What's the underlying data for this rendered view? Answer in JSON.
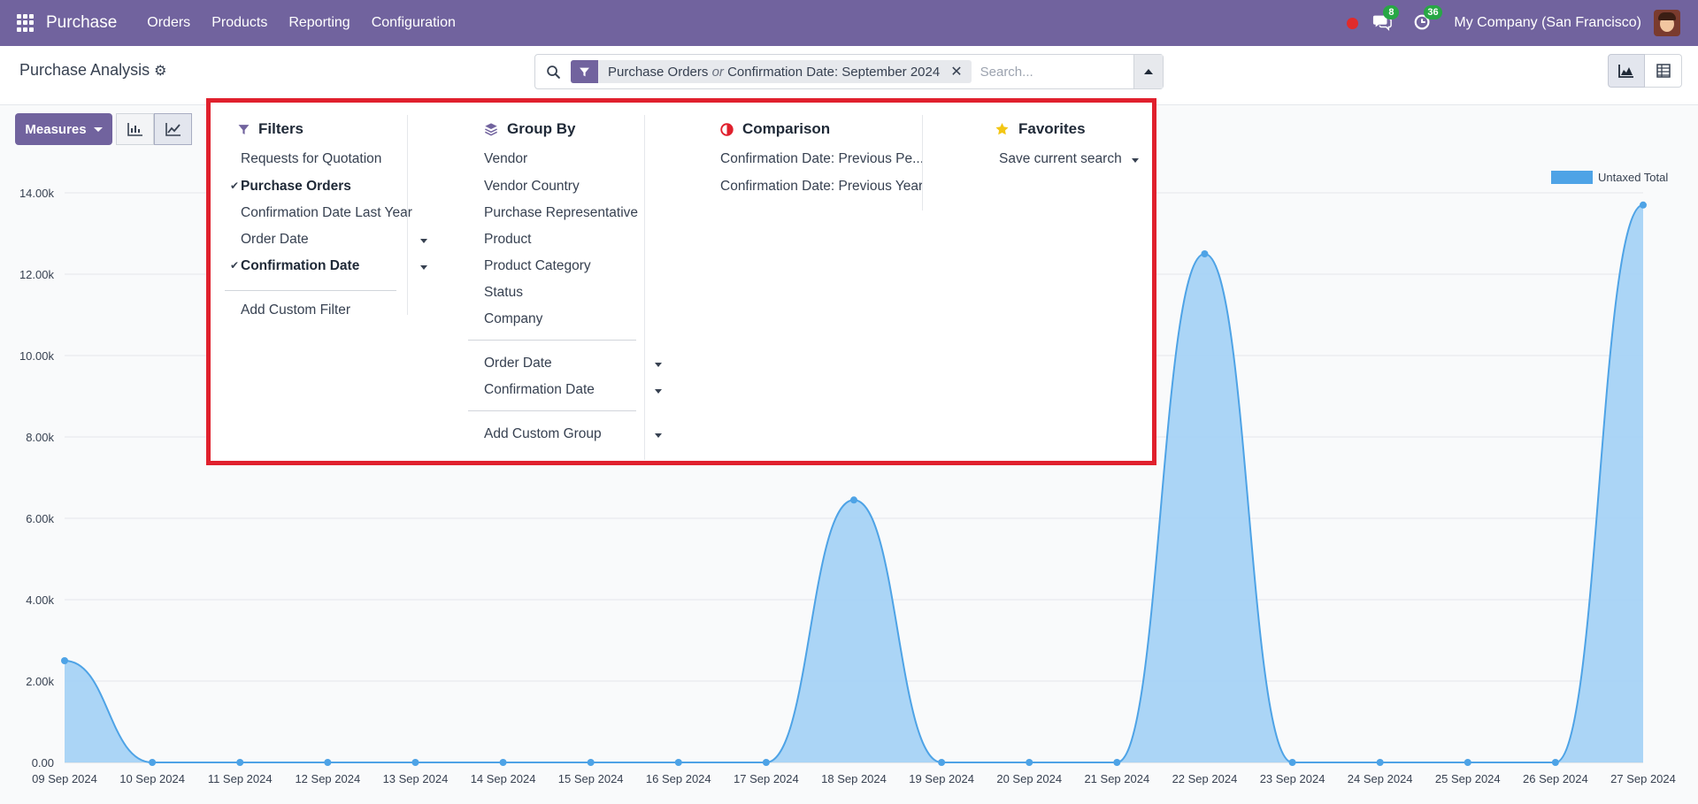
{
  "navbar": {
    "brand": "Purchase",
    "menu": [
      "Orders",
      "Products",
      "Reporting",
      "Configuration"
    ],
    "messages_count": "8",
    "activities_count": "36",
    "company": "My Company (San Francisco)"
  },
  "control": {
    "title": "Purchase Analysis",
    "facet": {
      "part1": "Purchase Orders",
      "or": "or",
      "part2": "Confirmation Date: September 2024"
    },
    "search_placeholder": "Search..."
  },
  "toolbar": {
    "measures_label": "Measures"
  },
  "dropdown": {
    "filters": {
      "title": "Filters",
      "items": [
        "Requests for Quotation",
        "Purchase Orders",
        "Confirmation Date Last Year",
        "Order Date",
        "Confirmation Date"
      ],
      "add_custom": "Add Custom Filter"
    },
    "group_by": {
      "title": "Group By",
      "items": [
        "Vendor",
        "Vendor Country",
        "Purchase Representative",
        "Product",
        "Product Category",
        "Status",
        "Company"
      ],
      "date_items": [
        "Order Date",
        "Confirmation Date"
      ],
      "add_custom": "Add Custom Group"
    },
    "comparison": {
      "title": "Comparison",
      "items": [
        "Confirmation Date: Previous Pe...",
        "Confirmation Date: Previous Year"
      ]
    },
    "favorites": {
      "title": "Favorites",
      "save_label": "Save current search"
    }
  },
  "colors": {
    "brand": "#71639e",
    "series": "#4ea3e6",
    "series_fill": "#a7d3f6",
    "highlight": "#e0202d"
  },
  "chart_data": {
    "type": "area",
    "legend": "Untaxed Total",
    "legend_position": "top-right",
    "x": [
      "09 Sep 2024",
      "10 Sep 2024",
      "11 Sep 2024",
      "12 Sep 2024",
      "13 Sep 2024",
      "14 Sep 2024",
      "15 Sep 2024",
      "16 Sep 2024",
      "17 Sep 2024",
      "18 Sep 2024",
      "19 Sep 2024",
      "20 Sep 2024",
      "21 Sep 2024",
      "22 Sep 2024",
      "23 Sep 2024",
      "24 Sep 2024",
      "25 Sep 2024",
      "26 Sep 2024",
      "27 Sep 2024"
    ],
    "series": [
      {
        "name": "Untaxed Total",
        "values": [
          2500,
          0,
          0,
          0,
          0,
          0,
          0,
          0,
          0,
          6450,
          0,
          0,
          0,
          12500,
          0,
          0,
          0,
          0,
          13700
        ]
      }
    ],
    "y_ticks": [
      "0.00",
      "2.00k",
      "4.00k",
      "6.00k",
      "8.00k",
      "10.00k",
      "12.00k",
      "14.00k"
    ],
    "ylim": [
      0,
      14000
    ],
    "grid": true
  }
}
